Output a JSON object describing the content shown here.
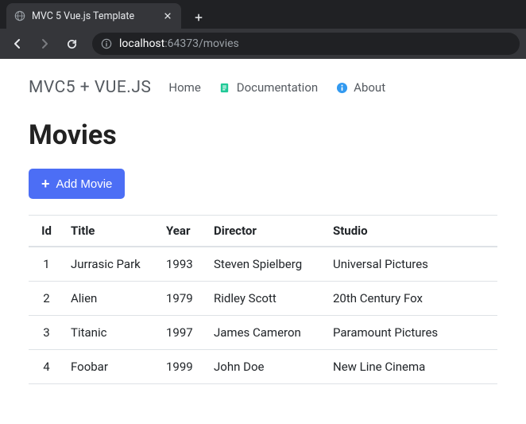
{
  "browser": {
    "tab_title": "MVC 5 Vue.js Template",
    "url_host": "localhost",
    "url_port": ":64373",
    "url_path": "/movies"
  },
  "nav": {
    "brand": "MVC5 + VUE.JS",
    "home_label": "Home",
    "docs_label": "Documentation",
    "about_label": "About"
  },
  "page": {
    "title": "Movies",
    "add_button_label": "Add Movie"
  },
  "table": {
    "headers": {
      "id": "Id",
      "title": "Title",
      "year": "Year",
      "director": "Director",
      "studio": "Studio"
    },
    "rows": [
      {
        "id": "1",
        "title": "Jurrasic Park",
        "year": "1993",
        "director": "Steven Spielberg",
        "studio": "Universal Pictures"
      },
      {
        "id": "2",
        "title": "Alien",
        "year": "1979",
        "director": "Ridley Scott",
        "studio": "20th Century Fox"
      },
      {
        "id": "3",
        "title": "Titanic",
        "year": "1997",
        "director": "James Cameron",
        "studio": "Paramount Pictures"
      },
      {
        "id": "4",
        "title": "Foobar",
        "year": "1999",
        "director": "John Doe",
        "studio": "New Line Cinema"
      }
    ]
  },
  "colors": {
    "primary": "#4c6ef5",
    "doc_icon": "#20c997",
    "info_icon": "#339af0"
  }
}
